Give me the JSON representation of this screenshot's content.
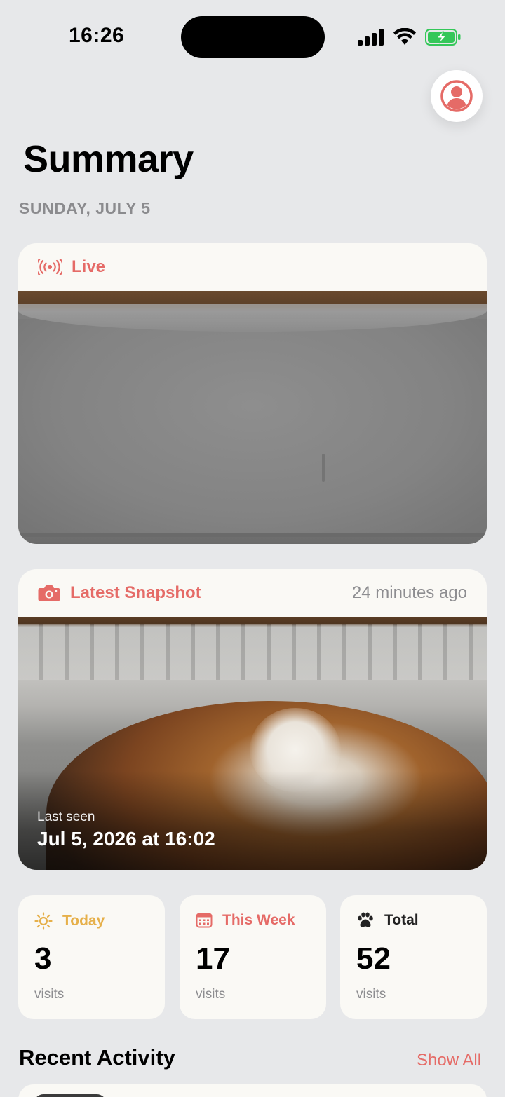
{
  "status_bar": {
    "time": "16:26"
  },
  "header": {
    "title": "Summary",
    "date": "SUNDAY, JULY 5"
  },
  "live": {
    "label": "Live"
  },
  "snapshot": {
    "label": "Latest Snapshot",
    "ago": "24 minutes ago",
    "last_seen_label": "Last seen",
    "last_seen_value": "Jul 5, 2026 at 16:02"
  },
  "stats": [
    {
      "label": "Today",
      "value": "3",
      "unit": "visits",
      "color": "#e6b04a",
      "icon": "sun-icon"
    },
    {
      "label": "This Week",
      "value": "17",
      "unit": "visits",
      "color": "#e56b67",
      "icon": "calendar-icon"
    },
    {
      "label": "Total",
      "value": "52",
      "unit": "visits",
      "color": "#222222",
      "icon": "paw-icon"
    }
  ],
  "recent_activity": {
    "title": "Recent Activity",
    "show_all": "Show All"
  },
  "colors": {
    "accent": "#e56b67",
    "background": "#e7e8ea",
    "card": "#faf9f5"
  }
}
